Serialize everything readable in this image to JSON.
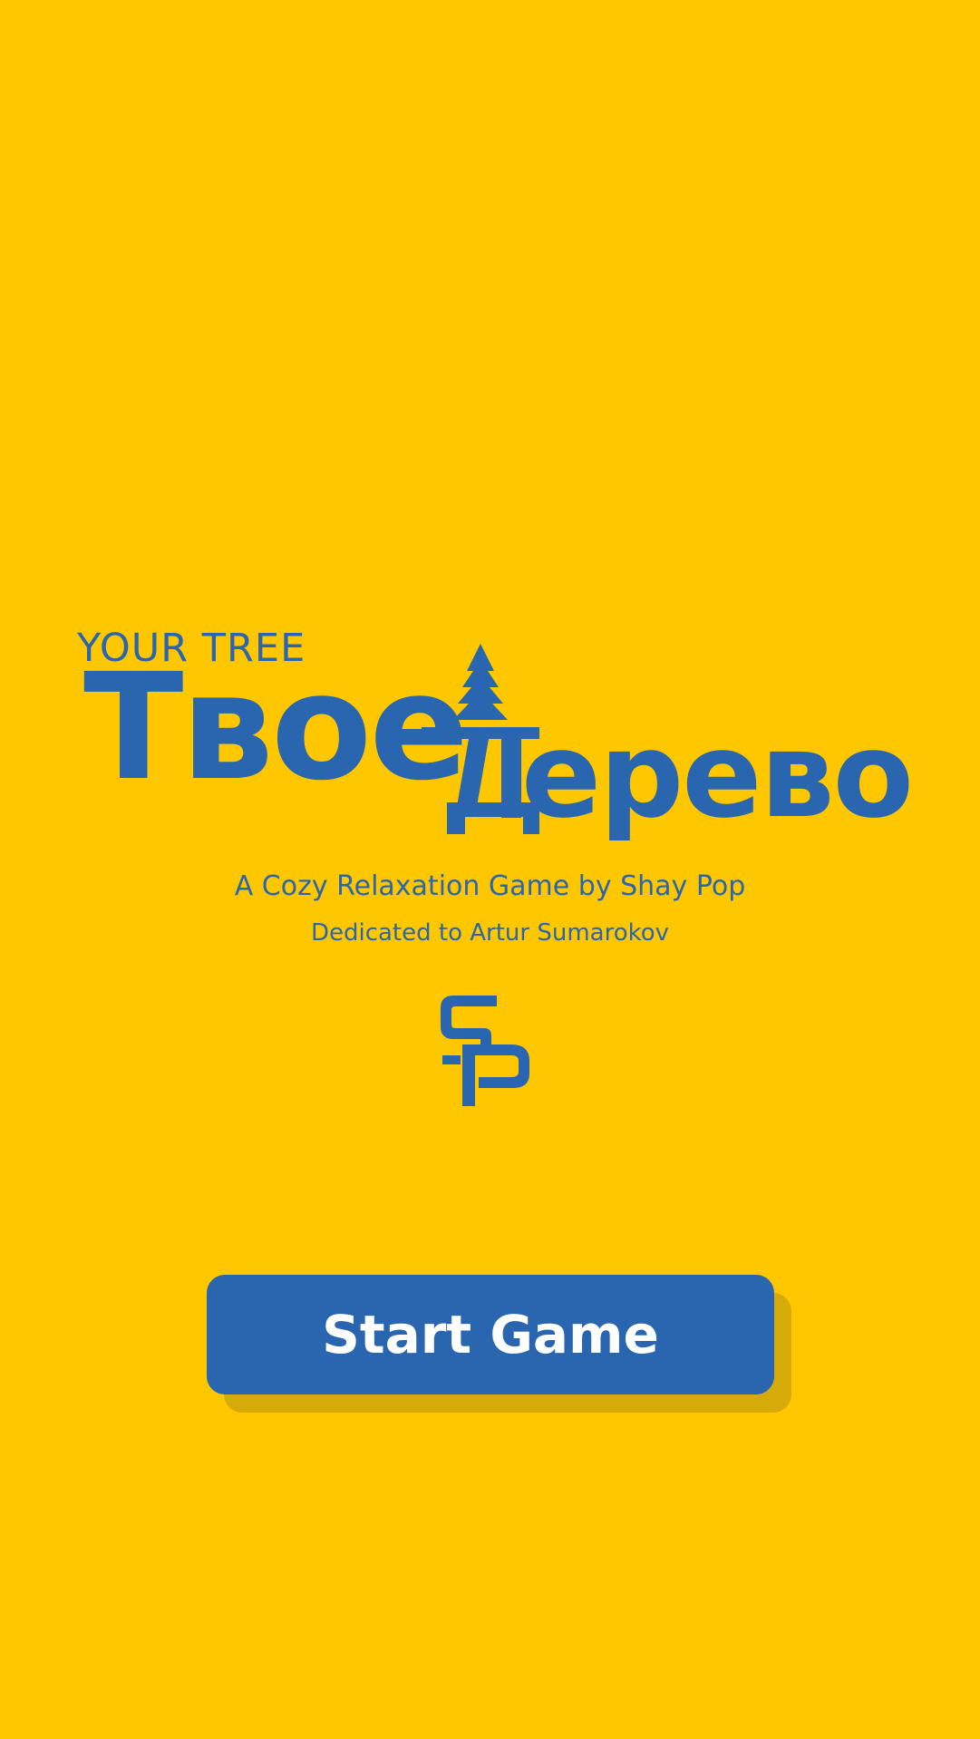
{
  "title": {
    "english": "YOUR TREE",
    "russian_part1": "Твое",
    "russian_part2": "ерево",
    "russian_full": "Твое Дерево"
  },
  "tagline": "A Cozy Relaxation Game by Shay Pop",
  "dedication": "Dedicated to Artur Sumarokov",
  "logo": {
    "icon": "sp-monogram-icon"
  },
  "start_button": {
    "label": "Start Game"
  },
  "colors": {
    "background": "#FFC700",
    "primary": "#2966AF",
    "button_text": "#FFFFFF",
    "button_shadow": "#D6AA08"
  }
}
